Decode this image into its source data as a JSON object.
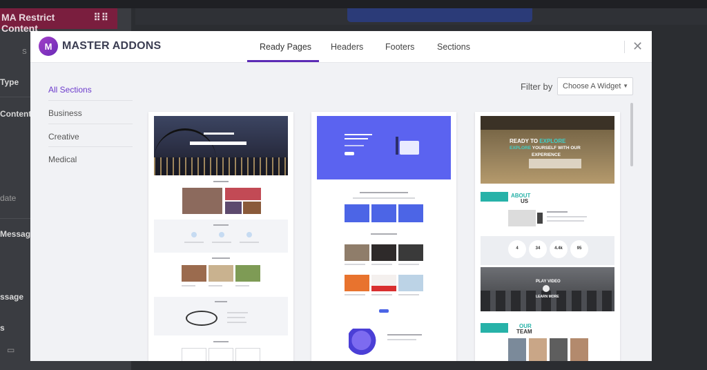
{
  "background": {
    "panel_title": "MA Restrict Content",
    "labels": [
      "Type",
      "Content",
      "date",
      "Message",
      "ssage",
      "s"
    ],
    "stub_label": "S"
  },
  "modal": {
    "brand": "MASTER ADDONS",
    "logo_letter": "M",
    "tabs": [
      {
        "label": "Ready Pages",
        "active": true
      },
      {
        "label": "Headers",
        "active": false
      },
      {
        "label": "Footers",
        "active": false
      },
      {
        "label": "Sections",
        "active": false
      }
    ],
    "close_glyph": "✕",
    "sidebar": [
      {
        "label": "All Sections",
        "active": true
      },
      {
        "label": "Business",
        "active": false
      },
      {
        "label": "Creative",
        "active": false
      },
      {
        "label": "Medical",
        "active": false
      }
    ],
    "filter": {
      "label": "Filter by",
      "value": "Choose A Widget",
      "caret": "▼"
    },
    "cards": [
      {
        "name": "business-template",
        "hero_color": "#2b2f44"
      },
      {
        "name": "learning-template",
        "hero_color": "#5b63f0"
      },
      {
        "name": "creative-template",
        "hero_color": "#8e7a57",
        "hero_text": [
          "READY TO",
          "EXPLORE",
          "EXPLORE",
          "YOURSELF WITH OUR",
          "EXPERIENCE"
        ],
        "about": "ABOUT",
        "about_us": "US",
        "stats": [
          "4",
          "34",
          "4.4k",
          "95"
        ],
        "video": "PLAY VIDEO",
        "video_sub": "LEARN MORE",
        "team": "OUR",
        "team2": "TEAM"
      }
    ]
  },
  "colors": {
    "accent": "#5b2bb5",
    "accent_text": "#6d3ccc",
    "teal": "#27b2a8",
    "blue": "#5b63f0"
  }
}
